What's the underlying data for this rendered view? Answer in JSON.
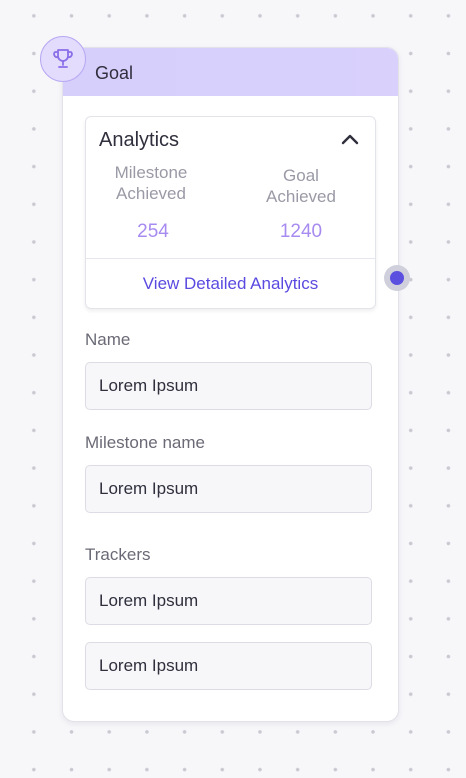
{
  "node": {
    "title": "Goal",
    "icon": "trophy-icon"
  },
  "analytics": {
    "title": "Analytics",
    "collapse_icon": "chevron-up-icon",
    "stats": [
      {
        "label": "Milestone Achieved",
        "value": "254"
      },
      {
        "label": "Goal Achieved",
        "value": "1240"
      }
    ],
    "link_label": "View Detailed Analytics"
  },
  "fields": {
    "name": {
      "label": "Name",
      "value": "Lorem Ipsum"
    },
    "milestone": {
      "label": "Milestone name",
      "value": "Lorem Ipsum"
    },
    "trackers": {
      "label": "Trackers",
      "values": [
        "Lorem Ipsum",
        "Lorem Ipsum"
      ]
    }
  },
  "colors": {
    "header": "#d6cefb",
    "accent": "#5b4fe0",
    "stat_value": "#a78bf0"
  }
}
